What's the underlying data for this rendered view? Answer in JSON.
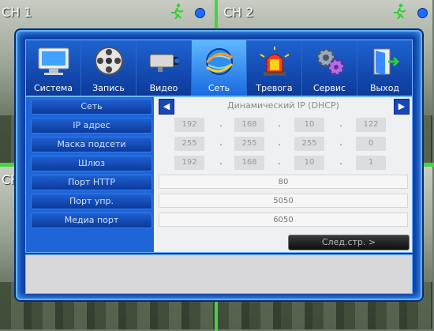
{
  "channels": [
    {
      "label": "CH 1"
    },
    {
      "label": "CH 2"
    },
    {
      "label": "CH"
    },
    {
      "label": ""
    }
  ],
  "menu": {
    "items": [
      {
        "label": "Система",
        "icon": "monitor-icon"
      },
      {
        "label": "Запись",
        "icon": "film-reel-icon"
      },
      {
        "label": "Видео",
        "icon": "camera-icon"
      },
      {
        "label": "Сеть",
        "icon": "globe-network-icon",
        "active": true
      },
      {
        "label": "Тревога",
        "icon": "siren-icon"
      },
      {
        "label": "Сервис",
        "icon": "gears-icon"
      },
      {
        "label": "Выход",
        "icon": "exit-door-icon"
      }
    ]
  },
  "network": {
    "labels": {
      "network": "Сеть",
      "ip": "IP адрес",
      "mask": "Маска подсети",
      "gateway": "Шлюз",
      "http_port": "Порт HTTP",
      "control_port": "Порт упр.",
      "media_port": "Медиа порт"
    },
    "mode": "Динамический IP (DHCP)",
    "ip": [
      "192",
      "168",
      "10",
      "122"
    ],
    "mask": [
      "255",
      "255",
      "255",
      "0"
    ],
    "gateway": [
      "192",
      "168",
      "10",
      "1"
    ],
    "http_port": "80",
    "control_port": "5050",
    "media_port": "6050",
    "separator": ".",
    "arrow_left": "◀",
    "arrow_right": "▶"
  },
  "buttons": {
    "next_page": "След.стр.  >"
  },
  "colors": {
    "dialog_bg": "#0b3ea8",
    "active_tab": "#1a6ae0",
    "divider": "#3fd63f",
    "status_dot": "#1e6cff"
  }
}
